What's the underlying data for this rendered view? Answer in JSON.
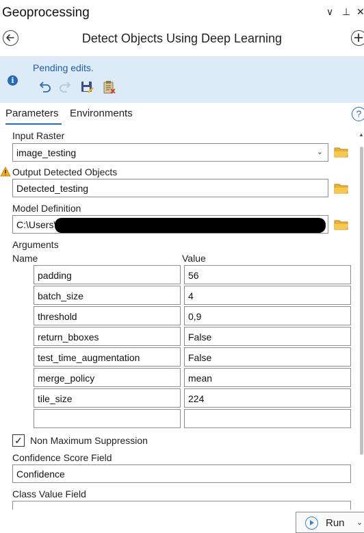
{
  "pane": {
    "title": "Geoprocessing",
    "icons": [
      "chevron-down-icon",
      "pin-icon",
      "close-icon"
    ],
    "glyphs": {
      "chevron": "∨",
      "pin": "⊥",
      "close": "✕"
    }
  },
  "tool": {
    "title": "Detect Objects Using Deep Learning",
    "back_icon": "back-arrow-icon",
    "add_icon": "add-circle-icon"
  },
  "info_bar": {
    "message": "Pending edits.",
    "icon": "info-icon",
    "info_glyph": "i",
    "buttons": [
      "undo-icon",
      "redo-icon",
      "save-edits-icon",
      "discard-edits-icon"
    ],
    "background": "#dcebf7"
  },
  "tabs": [
    {
      "label": "Parameters",
      "active": true
    },
    {
      "label": "Environments",
      "active": false
    }
  ],
  "help_glyph": "?",
  "parameters": {
    "input_raster": {
      "label": "Input Raster",
      "value": "image_testing"
    },
    "output_objects": {
      "label": "Output Detected Objects",
      "value": "Detected_testing",
      "warning": true
    },
    "model_definition": {
      "label": "Model Definition",
      "value": "C:\\Users\\"
    },
    "arguments": {
      "label": "Arguments",
      "col_name": "Name",
      "col_value": "Value",
      "rows": [
        {
          "name": "padding",
          "value": "56"
        },
        {
          "name": "batch_size",
          "value": "4"
        },
        {
          "name": "threshold",
          "value": "0,9"
        },
        {
          "name": "return_bboxes",
          "value": "False"
        },
        {
          "name": "test_time_augmentation",
          "value": "False"
        },
        {
          "name": "merge_policy",
          "value": "mean"
        },
        {
          "name": "tile_size",
          "value": "224"
        },
        {
          "name": "",
          "value": ""
        }
      ]
    },
    "nms": {
      "label": "Non Maximum Suppression",
      "checked": true,
      "check_glyph": "✓"
    },
    "confidence_field": {
      "label": "Confidence Score Field",
      "value": "Confidence"
    },
    "class_field": {
      "label": "Class Value Field",
      "value": ""
    }
  },
  "run": {
    "label": "Run",
    "caret": "⌄"
  },
  "colors": {
    "accent": "#2a6ab5",
    "folder": "#e8b23a",
    "warning": "#f2b01e"
  }
}
